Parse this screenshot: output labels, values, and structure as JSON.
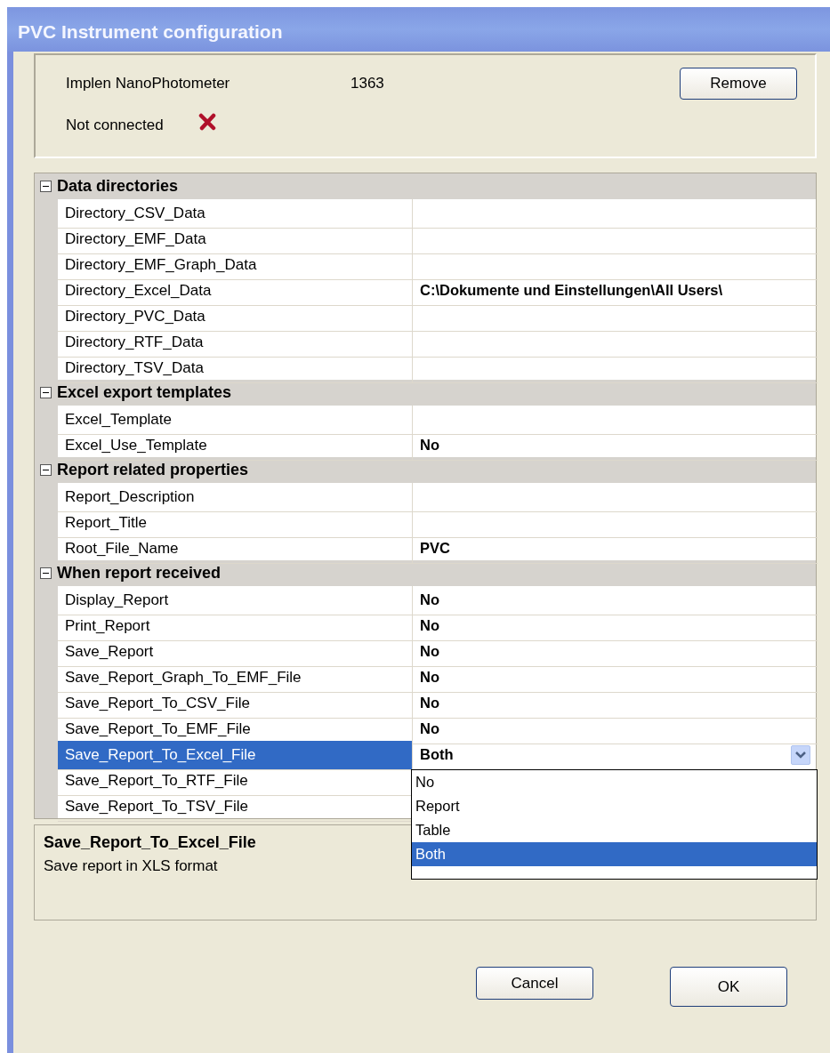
{
  "window": {
    "title": "PVC Instrument configuration"
  },
  "device": {
    "name": "Implen NanoPhotometer",
    "serial": "1363",
    "status": "Not connected",
    "connected": false,
    "remove_button": "Remove"
  },
  "grid": {
    "categories": [
      {
        "label": "Data directories",
        "expanded": true,
        "properties": [
          {
            "name": "Directory_CSV_Data",
            "selected": false
          },
          {
            "name": "Directory_EMF_Data",
            "selected": false
          },
          {
            "name": "Directory_EMF_Graph_Data",
            "selected": false
          },
          {
            "name": "Directory_Excel_Data",
            "value": "C:\\Dokumente und Einstellungen\\All Users\\",
            "selected": false
          },
          {
            "name": "Directory_PVC_Data",
            "selected": false
          },
          {
            "name": "Directory_RTF_Data",
            "selected": false
          },
          {
            "name": "Directory_TSV_Data",
            "selected": false
          }
        ]
      },
      {
        "label": "Excel export templates",
        "expanded": true,
        "properties": [
          {
            "name": "Excel_Template",
            "selected": false
          },
          {
            "name": "Excel_Use_Template",
            "value": "No",
            "selected": false
          }
        ]
      },
      {
        "label": "Report related properties",
        "expanded": true,
        "properties": [
          {
            "name": "Report_Description",
            "selected": false
          },
          {
            "name": "Report_Title",
            "selected": false
          },
          {
            "name": "Root_File_Name",
            "value": "PVC",
            "selected": false
          }
        ]
      },
      {
        "label": "When report received",
        "expanded": true,
        "properties": [
          {
            "name": "Display_Report",
            "value": "No",
            "selected": false
          },
          {
            "name": "Print_Report",
            "value": "No",
            "selected": false
          },
          {
            "name": "Save_Report",
            "value": "No",
            "selected": false
          },
          {
            "name": "Save_Report_Graph_To_EMF_File",
            "value": "No",
            "selected": false
          },
          {
            "name": "Save_Report_To_CSV_File",
            "value": "No",
            "selected": false
          },
          {
            "name": "Save_Report_To_EMF_File",
            "value": "No",
            "selected": false
          },
          {
            "name": "Save_Report_To_Excel_File",
            "value": "Both",
            "selected": true
          },
          {
            "name": "Save_Report_To_RTF_File",
            "selected": false
          },
          {
            "name": "Save_Report_To_TSV_File",
            "selected": false
          }
        ]
      }
    ]
  },
  "dropdown": {
    "options": [
      {
        "label": "No",
        "selected": false
      },
      {
        "label": "Report",
        "selected": false
      },
      {
        "label": "Table",
        "selected": false
      },
      {
        "label": "Both",
        "selected": true
      }
    ]
  },
  "description": {
    "title": "Save_Report_To_Excel_File",
    "text": "Save report in XLS format"
  },
  "buttons": [
    {
      "label": "Cancel",
      "kind": "cancel"
    },
    {
      "label": "OK",
      "kind": "ok"
    }
  ]
}
